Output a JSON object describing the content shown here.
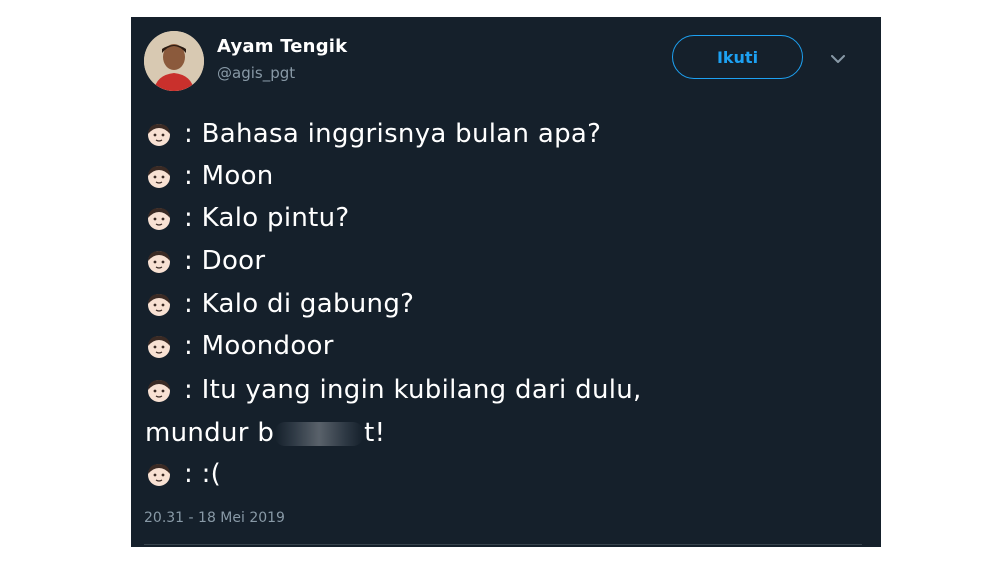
{
  "tweet": {
    "display_name": "Ayam Tengik",
    "handle": "@agis_pgt",
    "follow_label": "Ikuti",
    "timestamp": "20.31 - 18 Mei 2019",
    "lines": [
      ": Bahasa inggrisnya bulan apa?",
      ": Moon",
      ": Kalo pintu?",
      ": Door",
      ": Kalo di gabung?",
      ": Moondoor",
      ": Itu yang ingin kubilang dari dulu,",
      "mundur b",
      "t!",
      ": :("
    ]
  },
  "icons": {
    "avatar": "user-photo",
    "face": "face-emoji",
    "caret": "chevron-down-icon"
  },
  "colors": {
    "background": "#15202b",
    "text": "#ffffff",
    "muted": "#8899a6",
    "accent": "#1da1f2"
  }
}
